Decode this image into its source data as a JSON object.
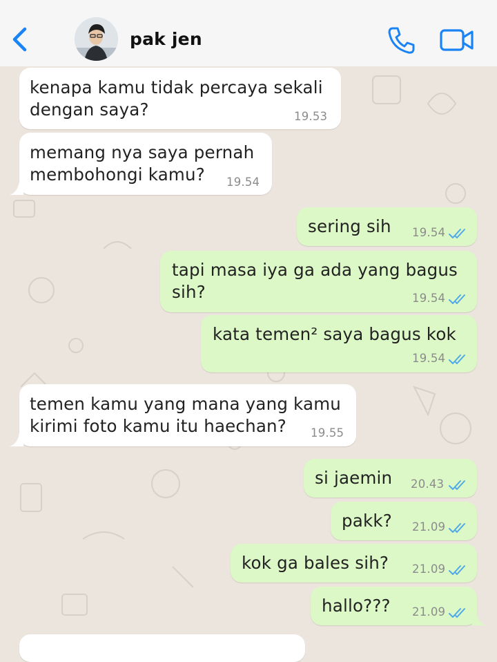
{
  "header": {
    "contact_name": "pak jen",
    "icons": [
      "back-chevron-icon",
      "avatar",
      "phone-icon",
      "video-icon"
    ],
    "accent_color": "#1a83f5"
  },
  "messages": [
    {
      "direction": "incoming",
      "lines": [
        "kenapa kamu tidak percaya sekali",
        "dengan saya?"
      ],
      "time": "19.53"
    },
    {
      "direction": "incoming",
      "lines": [
        "memang nya saya pernah",
        "membohongi kamu?"
      ],
      "time": "19.54"
    },
    {
      "direction": "outgoing",
      "lines": [
        "sering sih"
      ],
      "time": "19.54",
      "status": "read"
    },
    {
      "direction": "outgoing",
      "lines": [
        "tapi masa iya ga ada yang bagus",
        "sih?"
      ],
      "time": "19.54",
      "status": "read"
    },
    {
      "direction": "outgoing",
      "lines": [
        "kata temen² saya bagus kok"
      ],
      "time": "19.54",
      "status": "read"
    },
    {
      "direction": "incoming",
      "lines": [
        "temen kamu yang mana yang kamu",
        "kirimi foto kamu itu haechan?"
      ],
      "time": "19.55"
    },
    {
      "direction": "outgoing",
      "lines": [
        "si jaemin"
      ],
      "time": "20.43",
      "status": "read"
    },
    {
      "direction": "outgoing",
      "lines": [
        "pakk?"
      ],
      "time": "21.09",
      "status": "read"
    },
    {
      "direction": "outgoing",
      "lines": [
        "kok ga bales sih?"
      ],
      "time": "21.09",
      "status": "read"
    },
    {
      "direction": "outgoing",
      "lines": [
        "hallo???"
      ],
      "time": "21.09",
      "status": "read"
    }
  ],
  "colors": {
    "chat_background": "#ece5dd",
    "incoming_bubble": "#ffffff",
    "outgoing_bubble": "#dcf8c6",
    "read_ticks": "#4fa9e8"
  }
}
